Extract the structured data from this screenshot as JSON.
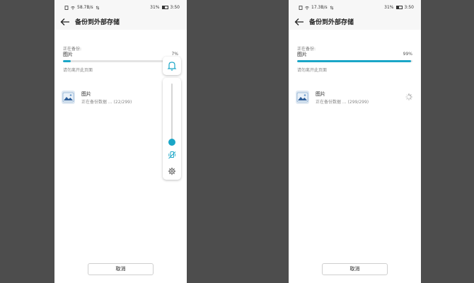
{
  "colors": {
    "accent": "#1aa6c7",
    "track": "#e4e4e4",
    "backdrop": "#4d4d4d"
  },
  "screens": [
    {
      "status": {
        "speed": "58.7B/s",
        "battery": "31%",
        "time": "3:50"
      },
      "title": "备份到外部存储",
      "progress": {
        "label": "正在备份:",
        "category": "图片",
        "percent_text": "7%",
        "value": 7,
        "hint": "请勿离开此页面"
      },
      "item": {
        "name": "图片",
        "status": "正在备份数据 ... (22/299)"
      },
      "cancel_label": "取消",
      "volume_panel": {
        "visible": true,
        "level": 0.05,
        "icons": [
          "bell-icon",
          "mute-vibrate-icon",
          "gear-icon"
        ]
      }
    },
    {
      "status": {
        "speed": "17.3B/s",
        "battery": "31%",
        "time": "3:50"
      },
      "title": "备份到外部存储",
      "progress": {
        "label": "正在备份:",
        "category": "图片",
        "percent_text": "99%",
        "value": 99,
        "hint": "请勿离开此页面"
      },
      "item": {
        "name": "图片",
        "status": "正在备份数据 ... (299/299)"
      },
      "cancel_label": "取消"
    }
  ]
}
